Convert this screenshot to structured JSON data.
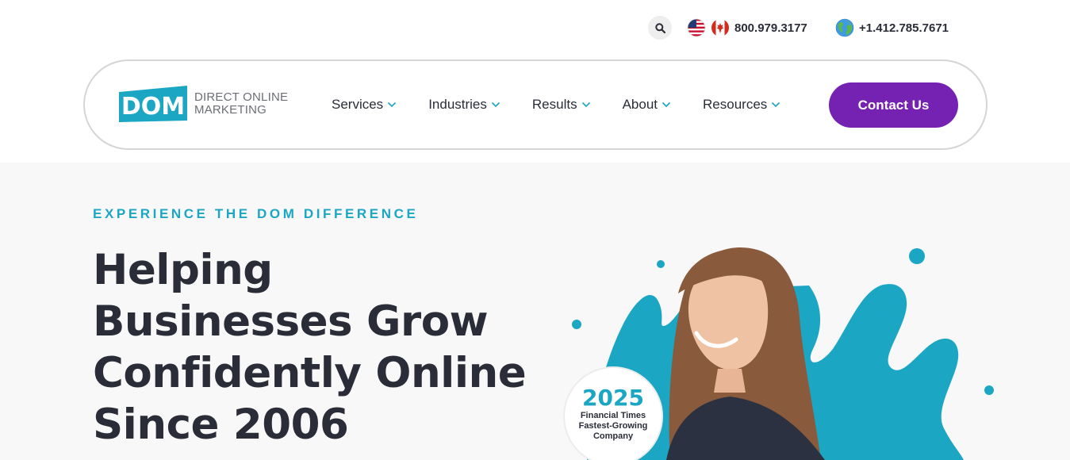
{
  "topbar": {
    "search_icon": "search-icon",
    "phone_na": "800.979.3177",
    "phone_intl": "+1.412.785.7671"
  },
  "logo": {
    "mark": "DOM",
    "line1": "DIRECT ONLINE",
    "line2": "MARKETING"
  },
  "nav": {
    "items": [
      {
        "label": "Services"
      },
      {
        "label": "Industries"
      },
      {
        "label": "Results"
      },
      {
        "label": "About"
      },
      {
        "label": "Resources"
      }
    ],
    "contact_label": "Contact Us"
  },
  "hero": {
    "eyebrow": "EXPERIENCE THE DOM DIFFERENCE",
    "headline": [
      "Helping",
      "Businesses Grow",
      "Confidently Online",
      "Since 2006"
    ],
    "badge": {
      "year": "2025",
      "line1": "Financial Times",
      "line2": "Fastest-Growing",
      "line3": "Company"
    }
  },
  "colors": {
    "accent": "#1ba6c4",
    "brand_purple": "#7522b3",
    "text_dark": "#2a2d38"
  }
}
